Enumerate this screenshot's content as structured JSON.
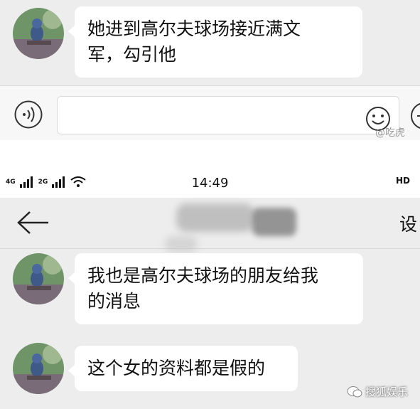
{
  "chat_top": {
    "message": "她进到高尔夫球场接近满文军，勾引他",
    "line1": "她进到高尔夫球场接近满文",
    "line2": "军，勾引他"
  },
  "input_bar": {
    "voice_icon": "voice-icon",
    "emoji_icon": "emoji-icon",
    "plus_icon": "plus-icon"
  },
  "watermark_top": "@吃虎",
  "status_bar": {
    "network_left": [
      "4G",
      "2G"
    ],
    "time": "14:49",
    "call_indicator": "HD"
  },
  "nav_bar": {
    "back_icon": "back-arrow-icon",
    "settings_label": "设"
  },
  "messages": [
    {
      "line1": "我也是高尔夫球场的朋友给我",
      "line2": "的消息"
    },
    {
      "line1": "这个女的资料都是假的"
    }
  ],
  "watermark_bottom": "搜狐娱乐",
  "colors": {
    "background": "#ededed",
    "bubble": "#ffffff",
    "divider": "#d8d8d8"
  }
}
